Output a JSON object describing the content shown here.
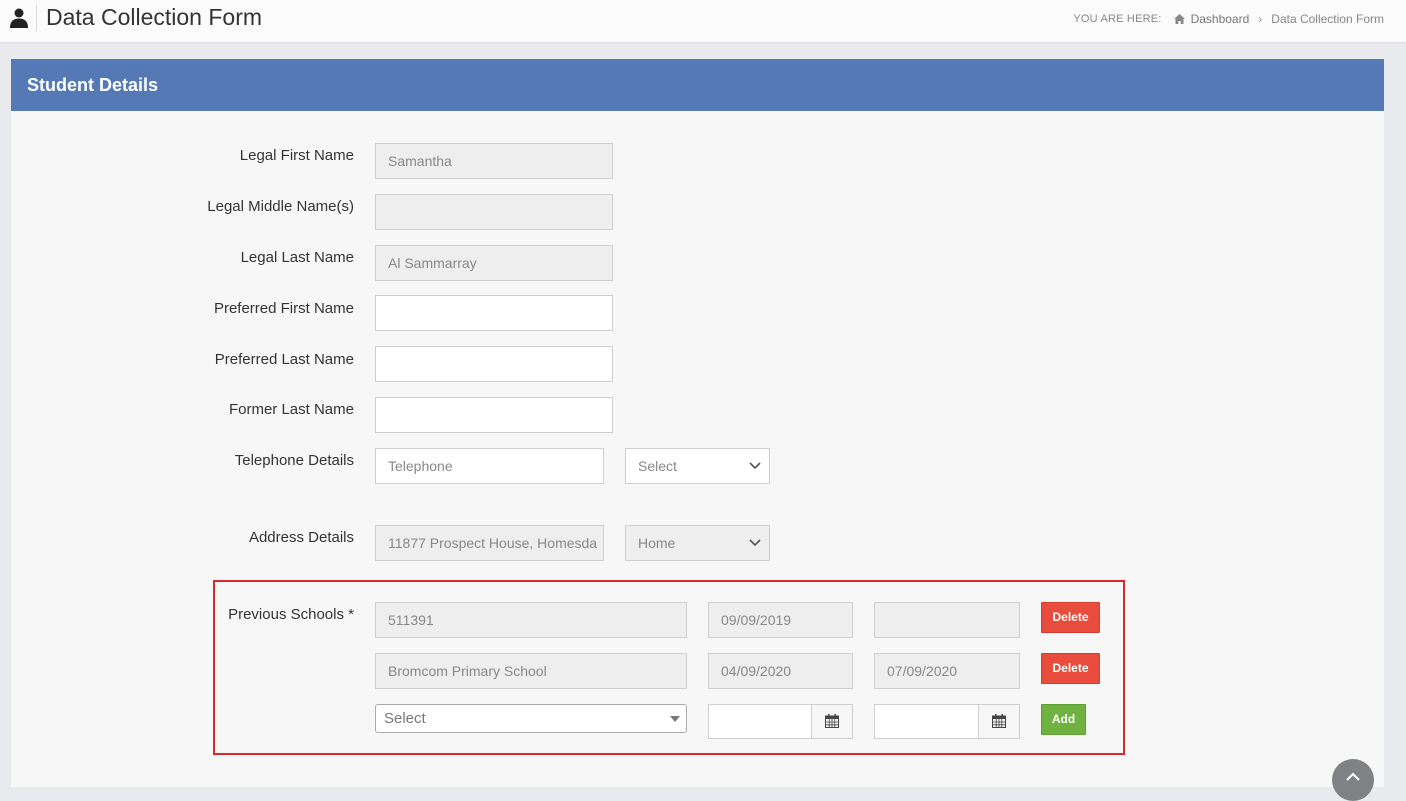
{
  "header": {
    "title": "Data Collection Form",
    "breadcrumb_prefix": "YOU ARE HERE:",
    "breadcrumb": [
      "Dashboard",
      "Data Collection Form"
    ],
    "icons": [
      "user-icon",
      "home-icon",
      "chevron-right-icon"
    ]
  },
  "panel": {
    "title": "Student Details",
    "header_color": "#5579b5"
  },
  "form": {
    "legal_first_name": {
      "label": "Legal First Name",
      "value": "Samantha"
    },
    "legal_middle_name": {
      "label": "Legal Middle Name(s)",
      "value": ""
    },
    "legal_last_name": {
      "label": "Legal Last Name",
      "value": "Al Sammarray"
    },
    "preferred_first_name": {
      "label": "Preferred First Name",
      "value": ""
    },
    "preferred_last_name": {
      "label": "Preferred Last Name",
      "value": ""
    },
    "former_last_name": {
      "label": "Former Last Name",
      "value": ""
    },
    "telephone": {
      "label": "Telephone Details",
      "placeholder": "Telephone",
      "type_value": "Select"
    },
    "address": {
      "label": "Address Details",
      "value": "11877 Prospect House, Homesda",
      "type_value": "Home"
    },
    "previous_schools": {
      "label": "Previous Schools *",
      "rows": [
        {
          "school": "511391",
          "start": "09/09/2019",
          "end": "",
          "action": "Delete"
        },
        {
          "school": "Bromcom Primary School",
          "start": "04/09/2020",
          "end": "07/09/2020",
          "action": "Delete"
        }
      ],
      "new_row": {
        "school_placeholder": "Select",
        "start": "",
        "end": "",
        "action": "Add"
      }
    }
  },
  "colors": {
    "delete_button": "#e74c3c",
    "add_button": "#6fb23f",
    "highlight_border": "#d62b2b"
  }
}
